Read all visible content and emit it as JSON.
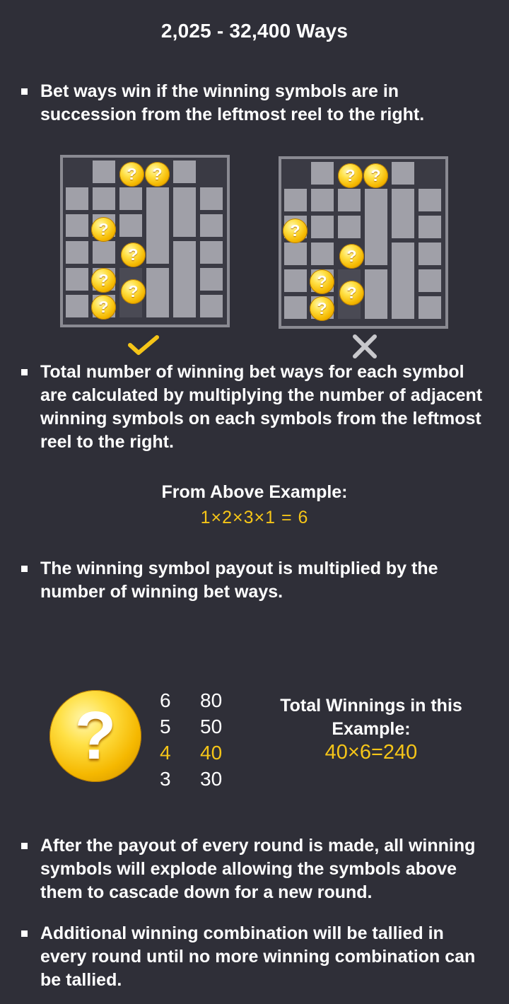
{
  "title": "2,025 - 32,400 Ways",
  "bullets": {
    "b1": "Bet ways win if the winning symbols are in succession from the leftmost reel to the right.",
    "b2": "Total number of winning bet ways for each symbol are calculated by multiplying the number of adjacent winning symbols on each symbols from the leftmost reel to the right.",
    "b3": "The winning symbol payout is multiplied by the number of winning bet ways.",
    "b4": "After the payout of every round is made, all winning symbols will explode allowing the symbols above them to cascade down for a new round.",
    "b5": "Additional winning combination will be tallied in every round until no more winning combination can be tallied."
  },
  "example": {
    "heading": "From Above Example:",
    "formula": "1×2×3×1 = 6"
  },
  "symbol": {
    "glyph": "?",
    "icon": "question-coin-icon"
  },
  "paytable": [
    {
      "count": "6",
      "payout": "80",
      "highlight": false
    },
    {
      "count": "5",
      "payout": "50",
      "highlight": false
    },
    {
      "count": "4",
      "payout": "40",
      "highlight": true
    },
    {
      "count": "3",
      "payout": "30",
      "highlight": false
    }
  ],
  "total": {
    "line1": "Total Winnings in this",
    "line2": "Example:",
    "value": "40×6=240"
  },
  "examples": {
    "valid_icon": "check-icon",
    "invalid_icon": "cross-icon"
  },
  "colors": {
    "background": "#2f2f38",
    "accent": "#f5c518",
    "cell": "#a0a0a8",
    "frame": "#8a8a92"
  }
}
